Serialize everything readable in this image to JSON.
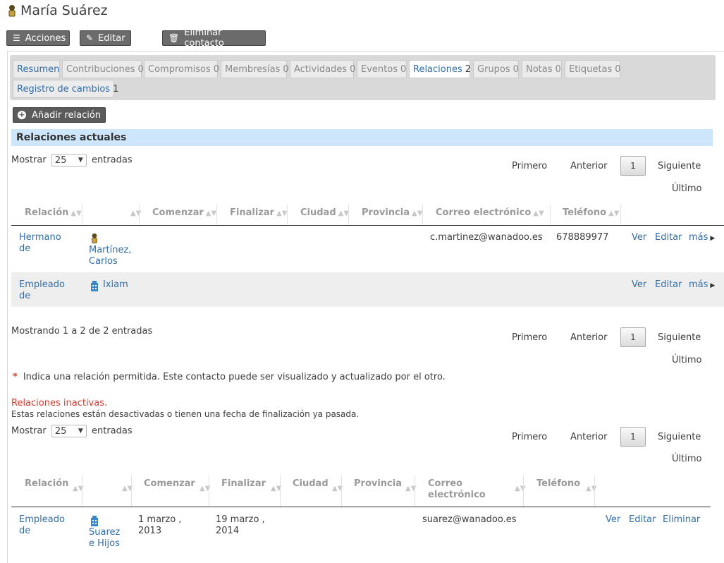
{
  "contact": {
    "name": "María Suárez"
  },
  "actions": {
    "acciones": "Acciones",
    "editar": "Editar",
    "eliminar": "Eliminar contacto"
  },
  "tabs": [
    {
      "label": "Resumen",
      "count": ""
    },
    {
      "label": "Contribuciones",
      "count": "0"
    },
    {
      "label": "Compromisos",
      "count": "0"
    },
    {
      "label": "Membresías",
      "count": "0"
    },
    {
      "label": "Actividades",
      "count": "0"
    },
    {
      "label": "Eventos",
      "count": "0"
    },
    {
      "label": "Relaciones",
      "count": "2"
    },
    {
      "label": "Grupos",
      "count": "0"
    },
    {
      "label": "Notas",
      "count": "0"
    },
    {
      "label": "Etiquetas",
      "count": "0"
    },
    {
      "label": "Registro de cambios",
      "count": "1"
    }
  ],
  "add_relation": "Añadir relación",
  "current": {
    "heading": "Relaciones actuales",
    "show_label": "Mostrar",
    "page_size": "25",
    "entries_label": "entradas",
    "pager": {
      "first": "Primero",
      "prev": "Anterior",
      "page": "1",
      "next": "Siguiente",
      "last": "Último"
    },
    "columns": [
      "Relación",
      "",
      "Comenzar",
      "Finalizar",
      "Ciudad",
      "Provincia",
      "Correo electrónico",
      "Teléfono"
    ],
    "rows": [
      {
        "relation_l1": "Hermano",
        "relation_l2": "de",
        "name_l1": "Martínez,",
        "name_l2": "Carlos",
        "email": "c.martinez@wanadoo.es",
        "phone": "678889977",
        "ver": "Ver",
        "editar": "Editar",
        "mas": "más"
      },
      {
        "relation_l1": "Empleado",
        "relation_l2": "de",
        "name_l1": "Ixiam",
        "name_l2": "",
        "email": "",
        "phone": "",
        "ver": "Ver",
        "editar": "Editar",
        "mas": "más"
      }
    ],
    "showing": "Mostrando 1 a 2 de 2 entradas"
  },
  "note": {
    "star": "*",
    "text": "Indica una relación permitida. Este contacto puede ser visualizado y actualizado por el otro."
  },
  "inactive": {
    "heading": "Relaciones inactivas.",
    "description": "Estas relaciones están desactivadas o tienen una fecha de finalización ya pasada.",
    "show_label": "Mostrar",
    "page_size": "25",
    "entries_label": "entradas",
    "pager": {
      "first": "Primero",
      "prev": "Anterior",
      "page": "1",
      "next": "Siguiente",
      "last": "Último"
    },
    "columns": [
      "Relación",
      "",
      "Comenzar",
      "Finalizar",
      "Ciudad",
      "Provincia",
      "Correo",
      "electrónico",
      "Teléfono"
    ],
    "rows": [
      {
        "relation_l1": "Empleado",
        "relation_l2": "de",
        "name_l1": "Suarez",
        "name_l2": "e Hijos",
        "start_l1": "1 marzo ,",
        "start_l2": "2013",
        "end_l1": "19 marzo ,",
        "end_l2": "2014",
        "email": "suarez@wanadoo.es",
        "ver": "Ver",
        "editar": "Editar",
        "eliminar": "Eliminar"
      }
    ]
  }
}
